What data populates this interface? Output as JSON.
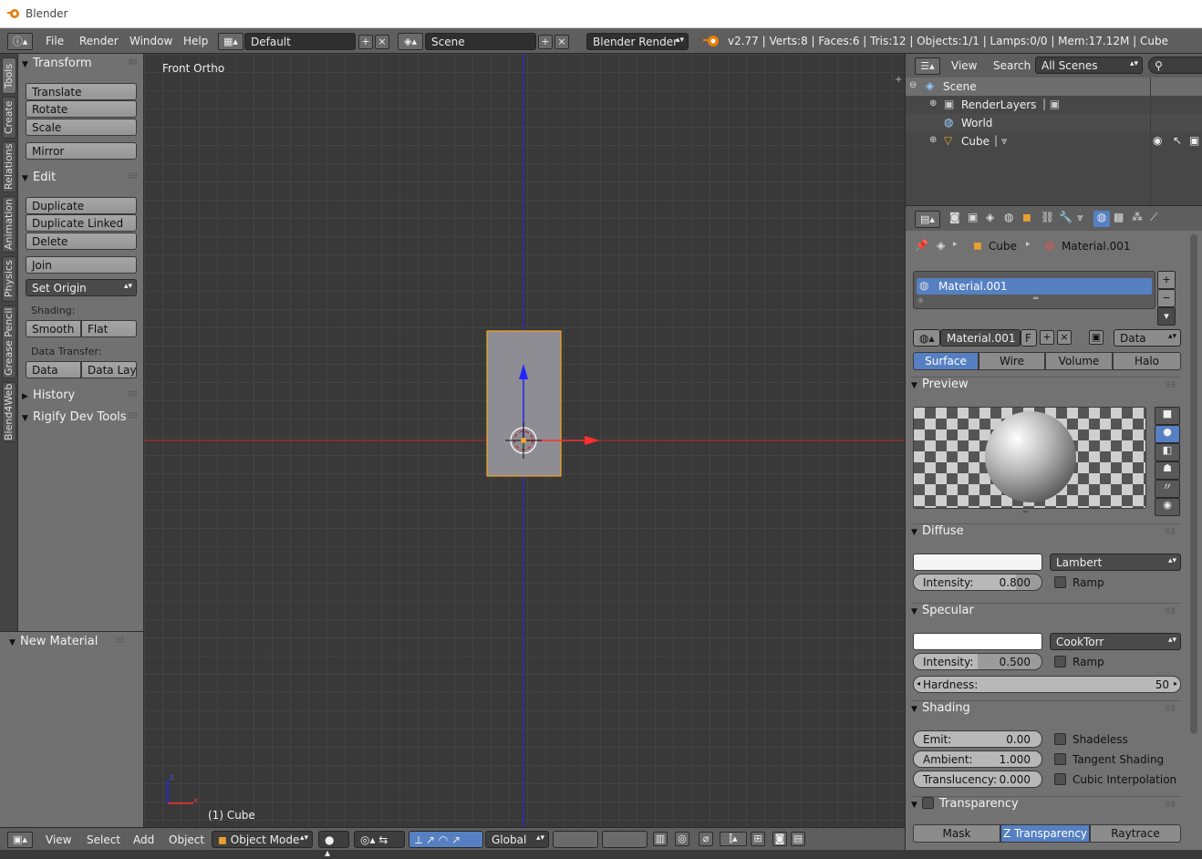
{
  "window": {
    "title": "Blender"
  },
  "info_header": {
    "menus": [
      "File",
      "Render",
      "Window",
      "Help"
    ],
    "layout": "Default",
    "scene": "Scene",
    "engine": "Blender Render",
    "stats": "v2.77 | Verts:8 | Faces:6 | Tris:12 | Objects:1/1 | Lamps:0/0 | Mem:17.12M | Cube"
  },
  "tab_strip": [
    "Tools",
    "Create",
    "Relations",
    "Animation",
    "Physics",
    "Grease Pencil",
    "Blend4Web"
  ],
  "tool_shelf": {
    "transform_title": "Transform",
    "translate": "Translate",
    "rotate": "Rotate",
    "scale": "Scale",
    "mirror": "Mirror",
    "edit_title": "Edit",
    "duplicate": "Duplicate",
    "duplicate_linked": "Duplicate Linked",
    "delete": "Delete",
    "join": "Join",
    "set_origin": "Set Origin",
    "shading_label": "Shading:",
    "smooth": "Smooth",
    "flat": "Flat",
    "data_transfer_label": "Data Transfer:",
    "data": "Data",
    "data_layo": "Data Layo",
    "history_title": "History",
    "rigify_title": "Rigify Dev Tools"
  },
  "new_material_title": "New Material",
  "viewport": {
    "view_label": "Front Ortho",
    "object_label": "(1) Cube"
  },
  "view3d_header": {
    "view": "View",
    "select": "Select",
    "add": "Add",
    "object": "Object",
    "mode": "Object Mode",
    "orientation": "Global"
  },
  "outliner": {
    "view": "View",
    "search": "Search",
    "display": "All Scenes",
    "rows": [
      "Scene",
      "RenderLayers",
      "World",
      "Cube"
    ]
  },
  "properties": {
    "breadcrumb_object": "Cube",
    "breadcrumb_material": "Material.001",
    "slot_name": "Material.001",
    "material_name": "Material.001",
    "fake_user": "F",
    "link": "Data",
    "tabs": [
      "Surface",
      "Wire",
      "Volume",
      "Halo"
    ],
    "active_tab": "Surface",
    "preview_title": "Preview",
    "diffuse_title": "Diffuse",
    "diffuse_shader": "Lambert",
    "diffuse_intensity_label": "Intensity:",
    "diffuse_intensity": "0.800",
    "diffuse_intensity_fill": 0.8,
    "ramp": "Ramp",
    "specular_title": "Specular",
    "specular_shader": "CookTorr",
    "specular_intensity_label": "Intensity:",
    "specular_intensity": "0.500",
    "specular_intensity_fill": 0.5,
    "hardness_label": "Hardness:",
    "hardness": "50",
    "shading_title": "Shading",
    "emit_label": "Emit:",
    "emit": "0.00",
    "ambient_label": "Ambient:",
    "ambient": "1.000",
    "translucency_label": "Translucency:",
    "translucency": "0.000",
    "shadeless": "Shadeless",
    "tangent_shading": "Tangent Shading",
    "cubic_interpolation": "Cubic Interpolation",
    "transparency_title": "Transparency",
    "transparency_modes": [
      "Mask",
      "Z Transparency",
      "Raytrace"
    ],
    "transparency_active": "Z Transparency"
  },
  "colors": {
    "accent": "#5680c2",
    "selection": "#f5a623",
    "x_axis": "#ff2d2d",
    "z_axis": "#2323ff"
  }
}
